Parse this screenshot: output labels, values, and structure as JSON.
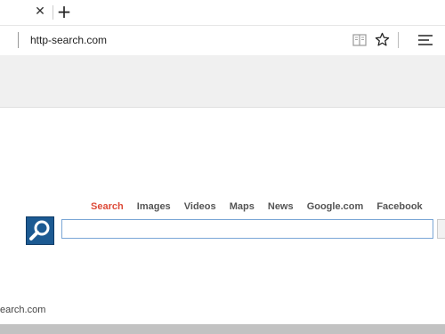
{
  "browser": {
    "tab_close_glyph": "✕",
    "new_tab_glyph": "+",
    "url": "http-search.com",
    "icons": {
      "reading_view": "reading-view-icon",
      "favorite": "star-icon",
      "hub": "hub-menu-icon"
    }
  },
  "search": {
    "nav": [
      {
        "label": "Search",
        "active": true
      },
      {
        "label": "Images",
        "active": false
      },
      {
        "label": "Videos",
        "active": false
      },
      {
        "label": "Maps",
        "active": false
      },
      {
        "label": "News",
        "active": false
      },
      {
        "label": "Google.com",
        "active": false
      },
      {
        "label": "Facebook",
        "active": false
      }
    ],
    "input_value": "",
    "logo_icon": "magnifier-logo-icon",
    "accent_color": "#dd4b39"
  },
  "footer": {
    "text": "earch.com"
  }
}
